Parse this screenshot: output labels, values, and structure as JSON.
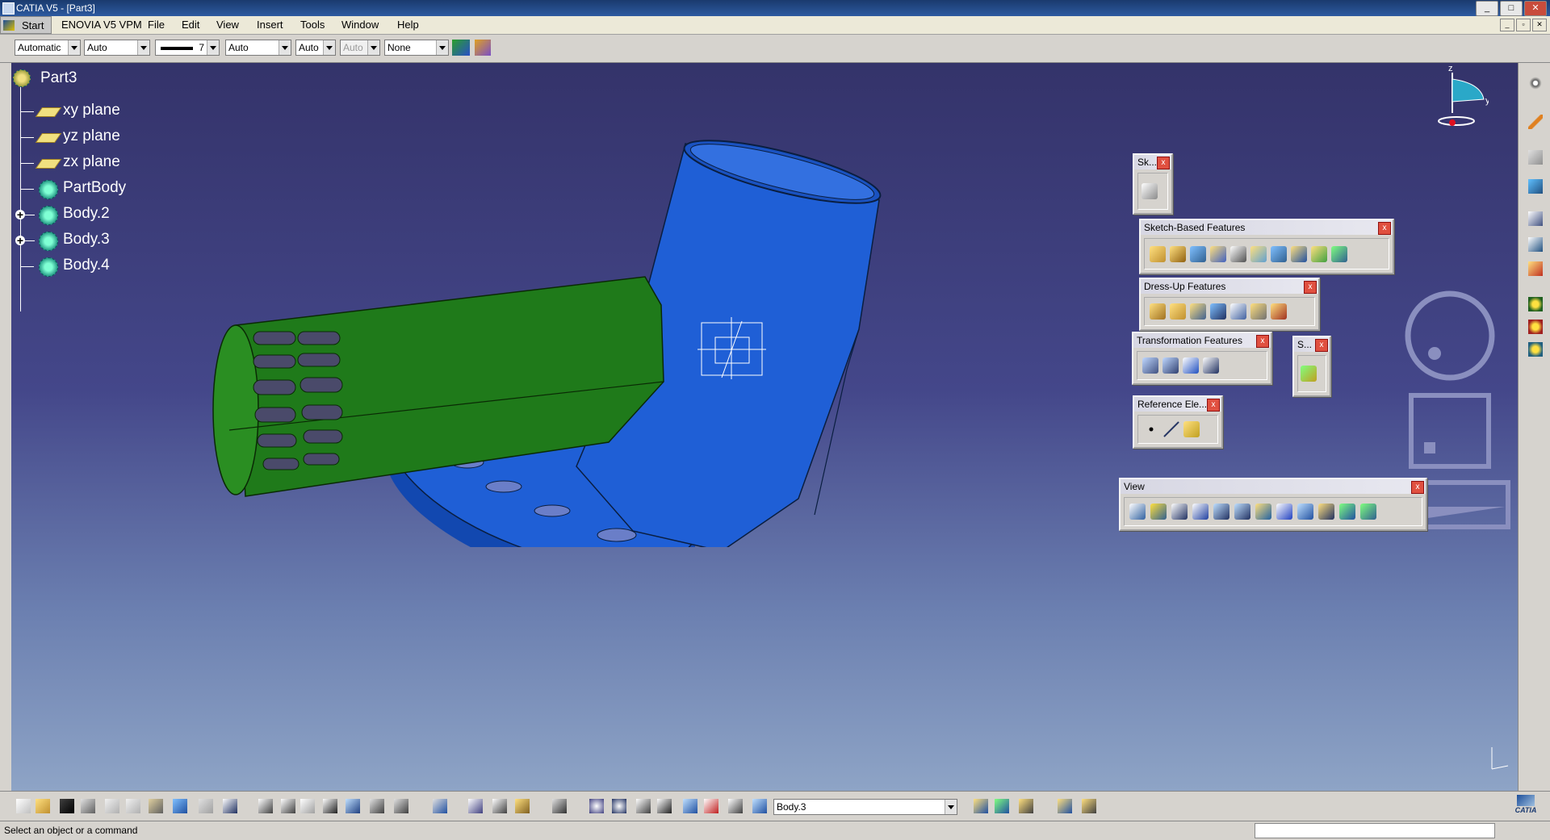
{
  "window": {
    "title": "CATIA V5 - [Part3]",
    "min": "_",
    "max": "□",
    "close": "✕"
  },
  "menu": {
    "start": "Start",
    "items": [
      "ENOVIA V5 VPM",
      "File",
      "Edit",
      "View",
      "Insert",
      "Tools",
      "Window",
      "Help"
    ]
  },
  "properties": {
    "color": "Automatic",
    "transparency": "Auto",
    "line_weight": "7",
    "line_type": "Auto",
    "point_type": "Auto",
    "layer_auto": "Auto",
    "layer": "None"
  },
  "tree": {
    "root": "Part3",
    "items": [
      "xy plane",
      "yz plane",
      "zx plane",
      "PartBody",
      "Body.2",
      "Body.3",
      "Body.4"
    ]
  },
  "toolbars": {
    "sketcher": "Sk...",
    "sketch_based": "Sketch-Based Features",
    "dress_up": "Dress-Up Features",
    "transformation": "Transformation Features",
    "surface": "S...",
    "reference": "Reference Ele...",
    "view": "View"
  },
  "compass_axes": {
    "z": "z",
    "y": "y"
  },
  "current_body": "Body.3",
  "status": {
    "message": "Select an object or a command"
  },
  "brand": "CATIA",
  "colors": {
    "green_body": "#1f7a1a",
    "blue_body": "#1f5fd6",
    "viewport_top": "#34336a"
  }
}
